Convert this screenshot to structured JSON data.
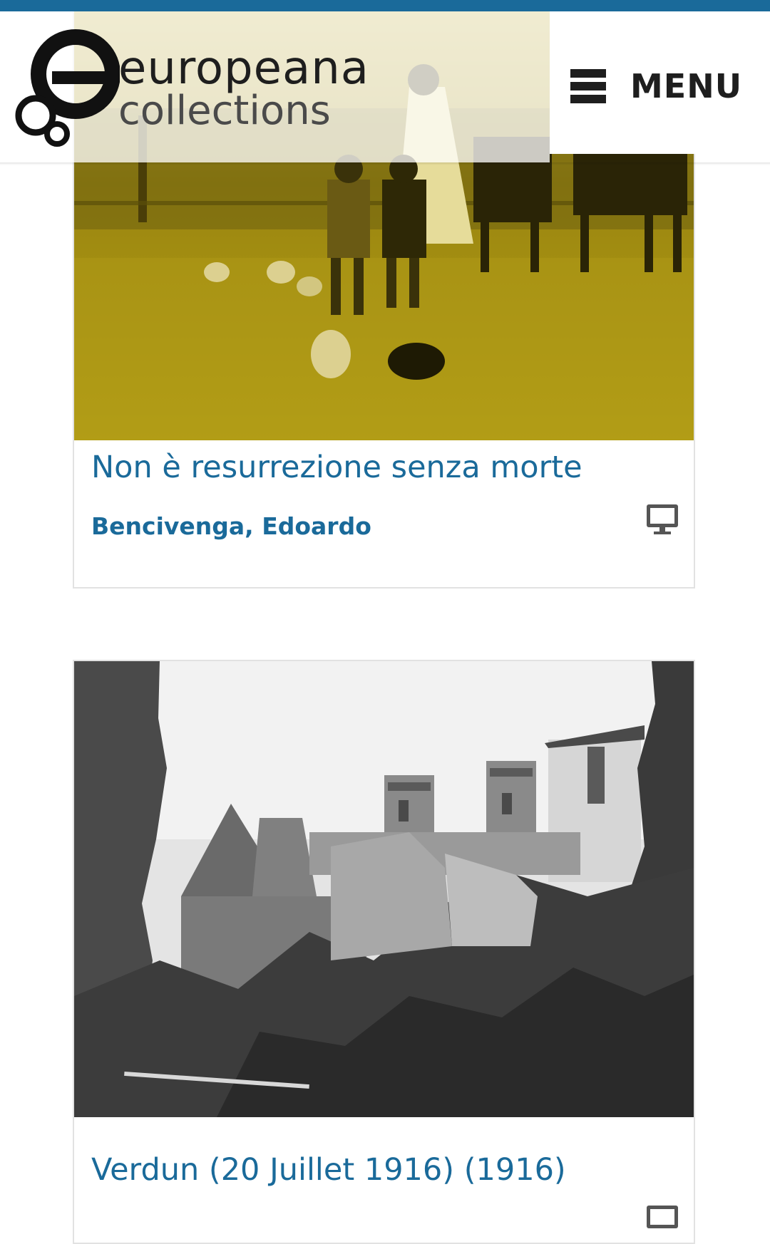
{
  "header": {
    "logo_line1": "europeana",
    "logo_line2": "collections",
    "menu_label": "MENU"
  },
  "cards": [
    {
      "title": "Non è resurrezione senza morte",
      "author": "Bencivenga, Edoardo",
      "type_icon": "desktop-monitor-icon",
      "image_tone": "yellow duotone"
    },
    {
      "title": "Verdun (20 Juillet 1916) (1916)",
      "type_icon": "monitor-icon",
      "image_tone": "black and white"
    }
  ],
  "colors": {
    "accent": "#1a6a9a",
    "text_dark": "#1e1e1e",
    "card_border": "#e2e2e2"
  }
}
